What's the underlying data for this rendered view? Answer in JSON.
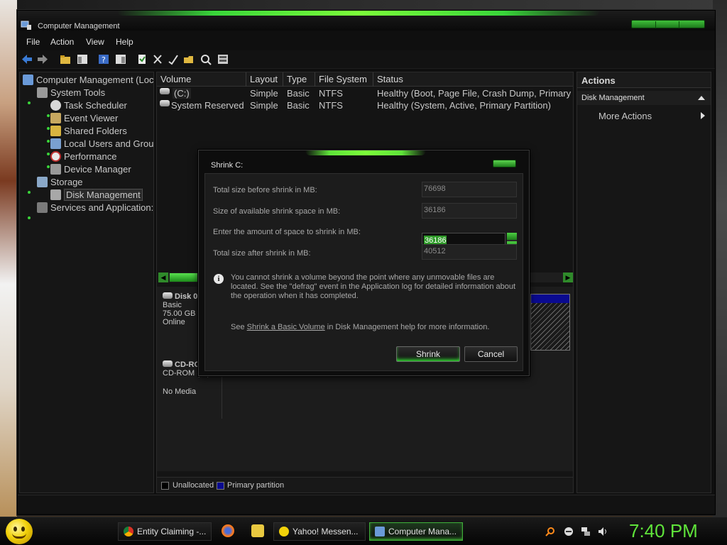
{
  "window": {
    "title": "Computer Management"
  },
  "menu": {
    "file": "File",
    "action": "Action",
    "view": "View",
    "help": "Help"
  },
  "tree": {
    "root": "Computer Management (Loc",
    "system_tools": "System Tools",
    "task_scheduler": "Task Scheduler",
    "event_viewer": "Event Viewer",
    "shared_folders": "Shared Folders",
    "local_users": "Local Users and Grou",
    "performance": "Performance",
    "device_manager": "Device Manager",
    "storage": "Storage",
    "disk_management": "Disk Management",
    "services": "Services and Application:"
  },
  "volumes": {
    "columns": [
      "Volume",
      "Layout",
      "Type",
      "File System",
      "Status"
    ],
    "rows": [
      {
        "volume": "(C:)",
        "layout": "Simple",
        "type": "Basic",
        "fs": "NTFS",
        "status": "Healthy (Boot, Page File, Crash Dump, Primary"
      },
      {
        "volume": "System Reserved",
        "layout": "Simple",
        "type": "Basic",
        "fs": "NTFS",
        "status": "Healthy (System, Active, Primary Partition)"
      }
    ]
  },
  "disks": {
    "disk0": {
      "name": "Disk 0",
      "type": "Basic",
      "size": "75.00 GB",
      "state": "Online"
    },
    "cdrom": {
      "name": "CD-RO",
      "type": "CD-ROM (D:)",
      "state": "No Media"
    }
  },
  "legend": {
    "unallocated": "Unallocated",
    "primary": "Primary partition",
    "unallocated_color": "#000000",
    "primary_color": "#0a0a90"
  },
  "actions": {
    "header": "Actions",
    "section": "Disk Management",
    "more": "More Actions"
  },
  "dialog": {
    "title": "Shrink C:",
    "total_before_label": "Total size before shrink in MB:",
    "total_before_value": "76698",
    "available_label": "Size of available shrink space in MB:",
    "available_value": "36186",
    "amount_label": "Enter the amount of space to shrink in MB:",
    "amount_value": "36186",
    "total_after_label": "Total size after shrink in MB:",
    "total_after_value": "40512",
    "info_text": "You cannot shrink a volume beyond the point where any unmovable files are located. See the \"defrag\" event in the Application log for detailed information about the operation when it has completed.",
    "see_prefix": "See ",
    "see_link": "Shrink a Basic Volume",
    "see_suffix": " in Disk Management help for more information.",
    "shrink_button": "Shrink",
    "cancel_button": "Cancel"
  },
  "taskbar": {
    "tasks": [
      "Entity Claiming -...",
      "Yahoo! Messen...",
      "Computer Mana..."
    ],
    "clock": "7:40 PM"
  },
  "colors": {
    "accent": "#5fe33a",
    "background": "#0f0f0f",
    "panel": "#161616"
  }
}
